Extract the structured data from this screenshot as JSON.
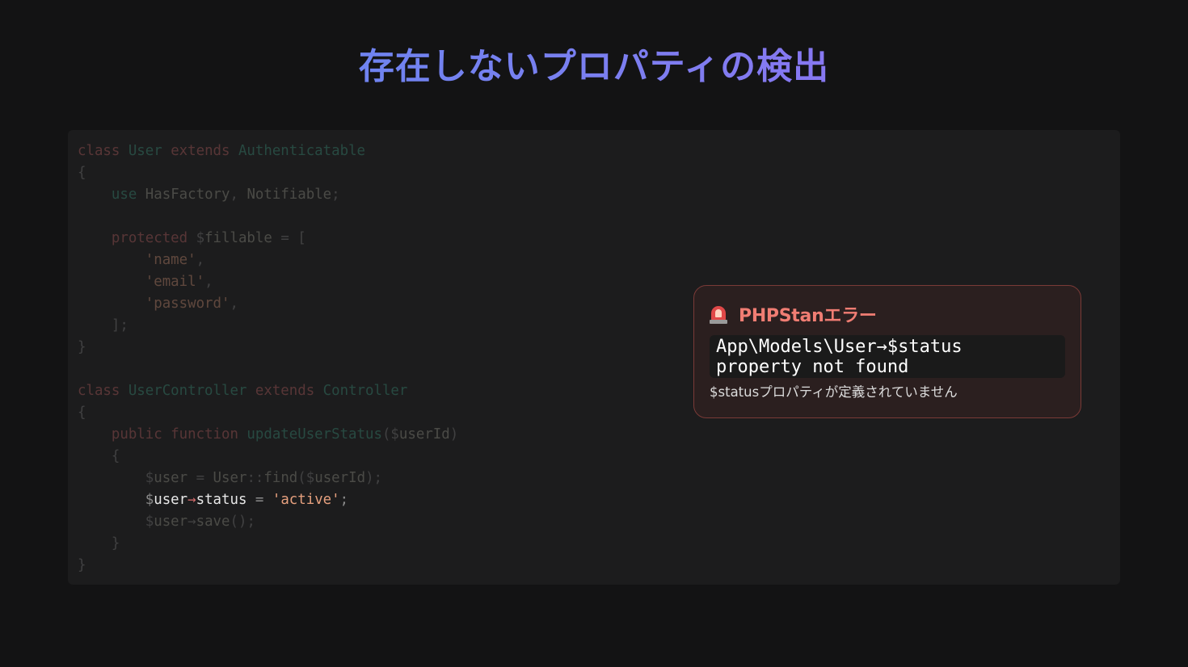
{
  "slide": {
    "title": "存在しないプロパティの検出"
  },
  "code_editor": {
    "language": "php",
    "focus_line": 17,
    "lines": [
      [
        [
          "k",
          "class "
        ],
        [
          "c",
          "User "
        ],
        [
          "k",
          "extends "
        ],
        [
          "c",
          "Authenticatable"
        ]
      ],
      [
        [
          "p",
          "{"
        ]
      ],
      [
        [
          "p",
          "    "
        ],
        [
          "c",
          "use "
        ],
        [
          "t",
          "HasFactory"
        ],
        [
          "p",
          ", "
        ],
        [
          "t",
          "Notifiable"
        ],
        [
          "p",
          ";"
        ]
      ],
      [],
      [
        [
          "p",
          "    "
        ],
        [
          "k",
          "protected "
        ],
        [
          "p",
          "$"
        ],
        [
          "t",
          "fillable "
        ],
        [
          "p",
          "= ["
        ]
      ],
      [
        [
          "p",
          "        "
        ],
        [
          "s",
          "'name'"
        ],
        [
          "p",
          ","
        ]
      ],
      [
        [
          "p",
          "        "
        ],
        [
          "s",
          "'email'"
        ],
        [
          "p",
          ","
        ]
      ],
      [
        [
          "p",
          "        "
        ],
        [
          "s",
          "'password'"
        ],
        [
          "p",
          ","
        ]
      ],
      [
        [
          "p",
          "    ];"
        ]
      ],
      [
        [
          "p",
          "}"
        ]
      ],
      [],
      [
        [
          "k",
          "class "
        ],
        [
          "c",
          "UserController "
        ],
        [
          "k",
          "extends "
        ],
        [
          "c",
          "Controller"
        ]
      ],
      [
        [
          "p",
          "{"
        ]
      ],
      [
        [
          "p",
          "    "
        ],
        [
          "k",
          "public "
        ],
        [
          "k",
          "function "
        ],
        [
          "c",
          "updateUserStatus"
        ],
        [
          "p",
          "($"
        ],
        [
          "t",
          "userId"
        ],
        [
          "p",
          ")"
        ]
      ],
      [
        [
          "p",
          "    {"
        ]
      ],
      [
        [
          "p",
          "        $"
        ],
        [
          "t",
          "user "
        ],
        [
          "p",
          "= "
        ],
        [
          "t",
          "User"
        ],
        [
          "p",
          "::"
        ],
        [
          "t",
          "find"
        ],
        [
          "p",
          "($"
        ],
        [
          "t",
          "userId"
        ],
        [
          "p",
          ");"
        ]
      ],
      [
        [
          "p",
          "        $"
        ],
        [
          "v",
          "user"
        ],
        [
          "k",
          "→"
        ],
        [
          "v",
          "status "
        ],
        [
          "p",
          "= "
        ],
        [
          "s",
          "'active'"
        ],
        [
          "p",
          ";"
        ]
      ],
      [
        [
          "p",
          "        $"
        ],
        [
          "t",
          "user"
        ],
        [
          "p",
          "→"
        ],
        [
          "t",
          "save"
        ],
        [
          "p",
          "();"
        ]
      ],
      [
        [
          "p",
          "    }"
        ]
      ],
      [
        [
          "p",
          "}"
        ]
      ]
    ]
  },
  "error_card": {
    "icon": "rotating-light-icon",
    "title": "PHPStanエラー",
    "message": "App\\Models\\User→$status\nproperty not found",
    "description": "$statusプロパティが定義されていません",
    "colors": {
      "accent": "#f07d73",
      "background": "#2b1f1f",
      "border": "#7a3a37"
    }
  }
}
